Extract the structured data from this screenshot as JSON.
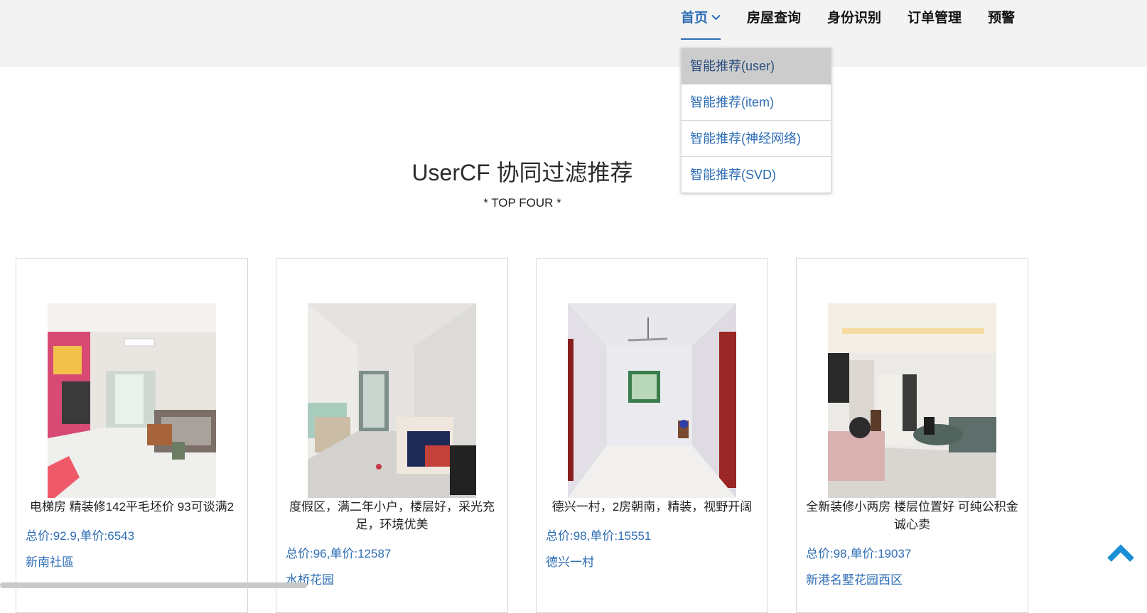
{
  "nav": {
    "items": [
      {
        "label": "首页",
        "active": true
      },
      {
        "label": "房屋查询",
        "active": false
      },
      {
        "label": "身份识别",
        "active": false
      },
      {
        "label": "订单管理",
        "active": false
      },
      {
        "label": "预警",
        "active": false
      }
    ],
    "dropdown": [
      {
        "label": "智能推荐(user)",
        "highlighted": true
      },
      {
        "label": "智能推荐(item)",
        "highlighted": false
      },
      {
        "label": "智能推荐(神经网络)",
        "highlighted": false
      },
      {
        "label": "智能推荐(SVD)",
        "highlighted": false
      }
    ]
  },
  "section": {
    "title": "UserCF 协同过滤推荐",
    "subtitle": "* TOP FOUR *"
  },
  "listings": [
    {
      "title": "电梯房 精装修142平毛坯价 93可谈满2",
      "price": "总价:92.9,单价:6543",
      "community": "新南社區"
    },
    {
      "title": "度假区，满二年小户，楼层好，采光充足，环境优美",
      "price": "总价:96,单价:12587",
      "community": "水桥花园"
    },
    {
      "title": "德兴一村，2房朝南，精装，视野开阔",
      "price": "总价:98,单价:15551",
      "community": "德兴一村"
    },
    {
      "title": "全新装修小两房 楼层位置好 可纯公积金 诚心卖",
      "price": "总价:98,单价:19037",
      "community": "新港名墅花园西区"
    }
  ],
  "colors": {
    "accent": "#2e6eb5",
    "topbar": "#f3f3f3",
    "back_top": "#1a8fd6"
  },
  "icons": {
    "dropdown_caret": "chevron-down-icon",
    "back_to_top": "chevron-up-icon"
  }
}
